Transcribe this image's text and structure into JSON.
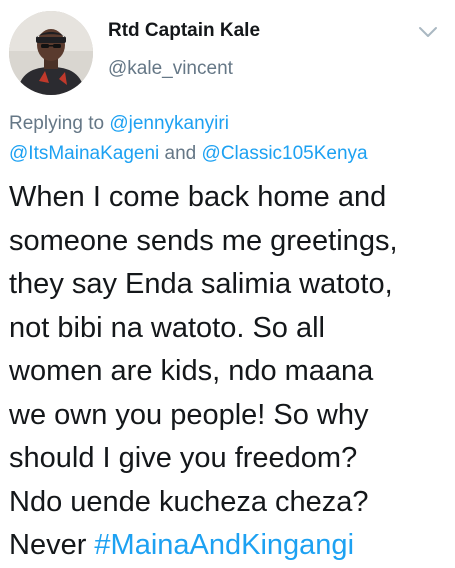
{
  "author": {
    "display_name": "Rtd Captain Kale",
    "handle": "@kale_vincent",
    "avatar_icon": "user-avatar"
  },
  "caret_icon": "chevron-down-icon",
  "reply": {
    "prefix": "Replying to ",
    "mention_1": "@jennykanyiri",
    "mention_2": "@ItsMainaKageni",
    "conjunction": " and ",
    "mention_3": "@Classic105Kenya"
  },
  "tweet": {
    "lines": [
      "When I come back home and",
      "someone sends me greetings,",
      "they say Enda salimia watoto,",
      "not bibi na watoto. So all",
      "women are kids, ndo maana",
      "we own you people! So why",
      "should I give you freedom?",
      "Ndo uende kucheza cheza?"
    ],
    "last_line_text": "Never ",
    "hashtag": "#MainaAndKingangi"
  },
  "colors": {
    "text": "#14171a",
    "secondary": "#657786",
    "link": "#1da1f2"
  }
}
